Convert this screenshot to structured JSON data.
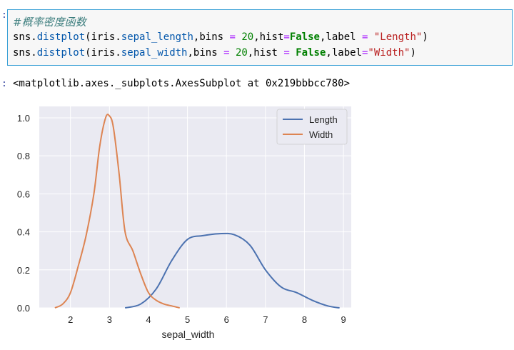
{
  "notebook": {
    "input_prompt": ":",
    "output_prompt": ":",
    "colors": {
      "cell_border": "#3aa0d6",
      "comment": "#408080",
      "keyword": "#008000",
      "operator": "#aa22ff",
      "number": "#008000",
      "string": "#ba2121",
      "name": "#0055aa"
    },
    "code": {
      "comment": "#概率密度函数",
      "line1": [
        {
          "t": "sns",
          "c": "plain"
        },
        {
          "t": ".",
          "c": "plain"
        },
        {
          "t": "distplot",
          "c": "name"
        },
        {
          "t": "(iris",
          "c": "plain"
        },
        {
          "t": ".",
          "c": "plain"
        },
        {
          "t": "sepal_length",
          "c": "name"
        },
        {
          "t": ",bins ",
          "c": "plain"
        },
        {
          "t": "=",
          "c": "operator"
        },
        {
          "t": " ",
          "c": "plain"
        },
        {
          "t": "20",
          "c": "number"
        },
        {
          "t": ",hist",
          "c": "plain"
        },
        {
          "t": "=",
          "c": "operator"
        },
        {
          "t": "False",
          "c": "keyword"
        },
        {
          "t": ",label ",
          "c": "plain"
        },
        {
          "t": "=",
          "c": "operator"
        },
        {
          "t": " ",
          "c": "plain"
        },
        {
          "t": "\"Length\"",
          "c": "string"
        },
        {
          "t": ")",
          "c": "plain"
        }
      ],
      "line2": [
        {
          "t": "sns",
          "c": "plain"
        },
        {
          "t": ".",
          "c": "plain"
        },
        {
          "t": "distplot",
          "c": "name"
        },
        {
          "t": "(iris",
          "c": "plain"
        },
        {
          "t": ".",
          "c": "plain"
        },
        {
          "t": "sepal_width",
          "c": "name"
        },
        {
          "t": ",bins ",
          "c": "plain"
        },
        {
          "t": "=",
          "c": "operator"
        },
        {
          "t": " ",
          "c": "plain"
        },
        {
          "t": "20",
          "c": "number"
        },
        {
          "t": ",hist ",
          "c": "plain"
        },
        {
          "t": "=",
          "c": "operator"
        },
        {
          "t": " ",
          "c": "plain"
        },
        {
          "t": "False",
          "c": "keyword"
        },
        {
          "t": ",label",
          "c": "plain"
        },
        {
          "t": "=",
          "c": "operator"
        },
        {
          "t": "\"Width\"",
          "c": "string"
        },
        {
          "t": ")",
          "c": "plain"
        }
      ]
    },
    "output_text": "<matplotlib.axes._subplots.AxesSubplot at 0x219bbbcc780>"
  },
  "chart_data": {
    "type": "line",
    "xlabel": "sepal_width",
    "ylabel": "",
    "xlim": [
      1.2,
      9.2
    ],
    "ylim": [
      0,
      1.06
    ],
    "xticks": [
      2,
      3,
      4,
      5,
      6,
      7,
      8,
      9
    ],
    "yticks": [
      0.0,
      0.2,
      0.4,
      0.6,
      0.8,
      1.0
    ],
    "xtick_labels": [
      "2",
      "3",
      "4",
      "5",
      "6",
      "7",
      "8",
      "9"
    ],
    "ytick_labels": [
      "0.0",
      "0.2",
      "0.4",
      "0.6",
      "0.8",
      "1.0"
    ],
    "grid": true,
    "legend_position": "top-right",
    "background": "#eaeaf2",
    "series": [
      {
        "name": "Length",
        "color": "#4c72b0",
        "x": [
          3.4,
          3.8,
          4.2,
          4.6,
          5.0,
          5.4,
          5.8,
          6.2,
          6.6,
          7.0,
          7.4,
          7.8,
          8.2,
          8.6,
          8.9
        ],
        "y": [
          0.0,
          0.02,
          0.1,
          0.25,
          0.36,
          0.38,
          0.39,
          0.385,
          0.33,
          0.2,
          0.11,
          0.08,
          0.04,
          0.01,
          0.0
        ]
      },
      {
        "name": "Width",
        "color": "#dd8452",
        "x": [
          1.6,
          1.8,
          2.0,
          2.2,
          2.4,
          2.6,
          2.75,
          2.9,
          3.0,
          3.1,
          3.25,
          3.4,
          3.6,
          3.8,
          4.0,
          4.2,
          4.4,
          4.6,
          4.8
        ],
        "y": [
          0.0,
          0.02,
          0.08,
          0.22,
          0.38,
          0.6,
          0.85,
          1.0,
          1.01,
          0.95,
          0.7,
          0.4,
          0.3,
          0.18,
          0.08,
          0.04,
          0.02,
          0.01,
          0.0
        ]
      }
    ]
  }
}
